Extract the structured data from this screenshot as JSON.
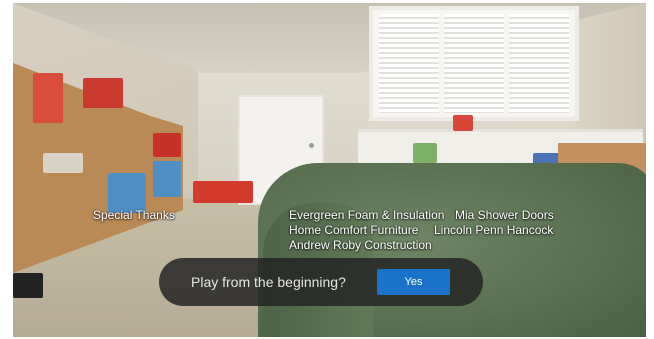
{
  "credits": {
    "special_thanks": "Special Thanks",
    "sponsors": [
      "Evergreen Foam & Insulation",
      "Mia Shower Doors",
      "Home Comfort Furniture",
      "Lincoln Penn Hancock",
      "Andrew Roby Construction"
    ]
  },
  "prompt": {
    "message": "Play from the beginning?",
    "yes_label": "Yes"
  },
  "colors": {
    "overlay_bg": "#242424",
    "accent_button": "#1a73c9"
  }
}
